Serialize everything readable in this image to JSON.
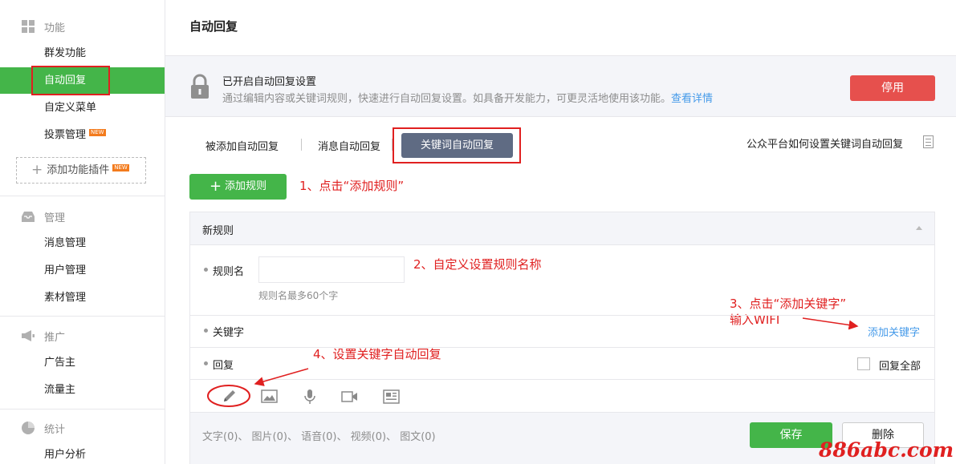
{
  "sidebar": {
    "features_header": "功能",
    "features_items": [
      {
        "label": "群发功能"
      },
      {
        "label": "自动回复"
      },
      {
        "label": "自定义菜单"
      },
      {
        "label": "投票管理",
        "badge": "NEW"
      }
    ],
    "add_plugin": {
      "label": "添加功能插件",
      "badge": "NEW"
    },
    "manage_header": "管理",
    "manage_items": [
      {
        "label": "消息管理"
      },
      {
        "label": "用户管理"
      },
      {
        "label": "素材管理"
      }
    ],
    "promo_header": "推广",
    "promo_items": [
      {
        "label": "广告主"
      },
      {
        "label": "流量主"
      }
    ],
    "stats_header": "统计",
    "stats_items": [
      {
        "label": "用户分析"
      }
    ],
    "active_color": "#44b549"
  },
  "main": {
    "title": "自动回复",
    "banner": {
      "title": "已开启自动回复设置",
      "desc": "通过编辑内容或关键词规则，快速进行自动回复设置。如具备开发能力，可更灵活地使用该功能。",
      "link": "查看详情",
      "disable_label": "停用",
      "icon": "lock-icon"
    },
    "tabs": [
      {
        "label": "被添加自动回复"
      },
      {
        "label": "消息自动回复"
      },
      {
        "label": "关键词自动回复",
        "active": true
      }
    ],
    "help_link": "公众平台如何设置关键词自动回复",
    "add_rule_label": "添加规则",
    "rule": {
      "header": "新规则",
      "name_label": "规则名",
      "name_value": "",
      "name_hint": "规则名最多60个字",
      "keyword_label": "关键字",
      "add_keyword": "添加关键字",
      "reply_label": "回复",
      "reply_all": "回复全部",
      "media_icons": [
        "pencil-icon",
        "image-icon",
        "microphone-icon",
        "video-icon",
        "article-icon"
      ],
      "counts": "文字(0)、 图片(0)、 语音(0)、 视频(0)、 图文(0)",
      "save_label": "保存",
      "delete_label": "删除"
    }
  },
  "annotations": {
    "step1": "1、点击“添加规则”",
    "step2": "2、自定义设置规则名称",
    "step3_line1": "3、点击“添加关键字”",
    "step3_line2": "输入WIFI",
    "step4": "4、设置关键字自动回复",
    "color": "#e02020"
  },
  "watermark": "886abc.com"
}
